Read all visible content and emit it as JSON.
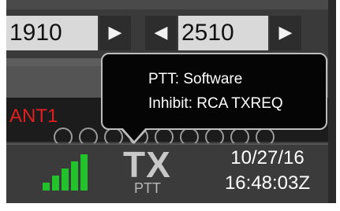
{
  "frequency": {
    "lower_value": "1910",
    "upper_value": "2510",
    "lower_increase_glyph": "▶",
    "upper_decrease_glyph": "◀",
    "upper_increase_glyph": "▶"
  },
  "antenna": {
    "label": "ANT1"
  },
  "status": {
    "signal_level": {
      "bars_lit": 5,
      "bars_total": 5
    },
    "signal_color": "#22c22a",
    "tx_indicator": "TX",
    "tx_source": "PTT",
    "date": "10/27/16",
    "time": "16:48:03Z"
  },
  "tooltip": {
    "line1": "PTT: Software",
    "line2": "Inhibit: RCA TXREQ"
  }
}
